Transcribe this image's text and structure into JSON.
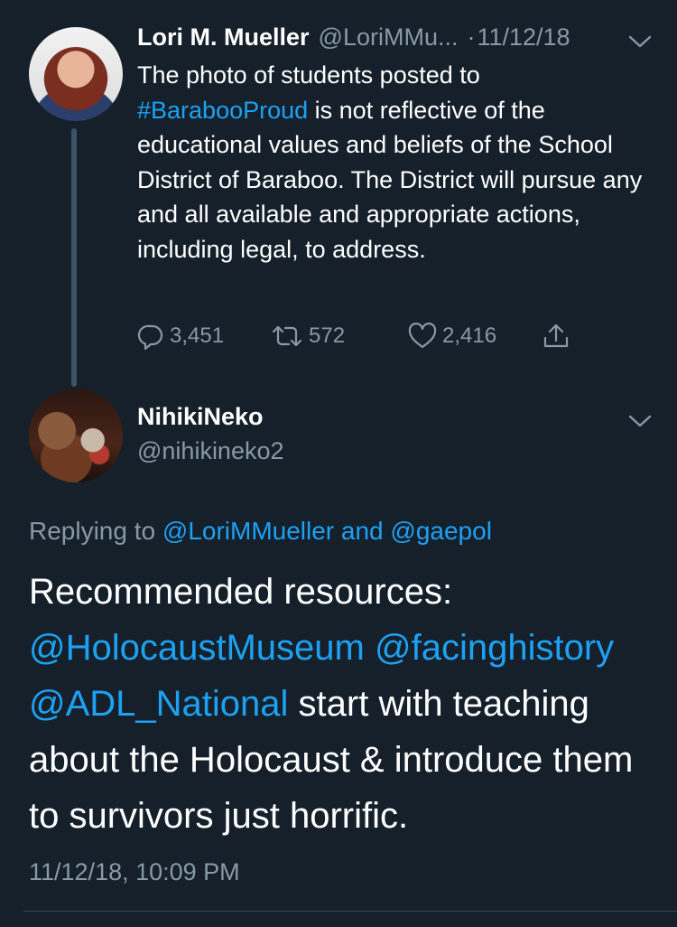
{
  "parent_tweet": {
    "display_name": "Lori M. Mueller",
    "handle": "@LoriMMu...",
    "separator": "·",
    "date": "11/12/18",
    "text_before": "The photo of students posted to ",
    "hashtag": "#BarabooProud",
    "text_after": " is not reflective of the educational values and beliefs of the School District of Baraboo.  The District will pursue any and all available and appropriate actions, including legal, to address.",
    "reply_count": "3,451",
    "retweet_count": "572",
    "like_count": "2,416",
    "icons": [
      "chevron-down-icon",
      "reply-icon",
      "retweet-icon",
      "like-icon",
      "share-icon"
    ]
  },
  "reply_tweet": {
    "display_name": "NihikiNeko",
    "handle": "@nihikineko2",
    "replying_prefix": "Replying to ",
    "replying_user1": "@LoriMMueller",
    "replying_and": " and ",
    "replying_user2": "@gaepol",
    "text_intro": "Recommended resources: ",
    "mention1": "@HolocaustMuseum",
    "space1": " ",
    "mention2": "@facinghistory",
    "space2": " ",
    "mention3": "@ADL_National",
    "text_rest": " start with teaching about the Holocaust & introduce them to survivors just horrific.",
    "timestamp": "11/12/18, 10:09 PM"
  },
  "colors": {
    "background": "#15202b",
    "text": "#ffffff",
    "secondary": "#8899a6",
    "link": "#1da1f2",
    "thread_line": "#3d5466"
  }
}
